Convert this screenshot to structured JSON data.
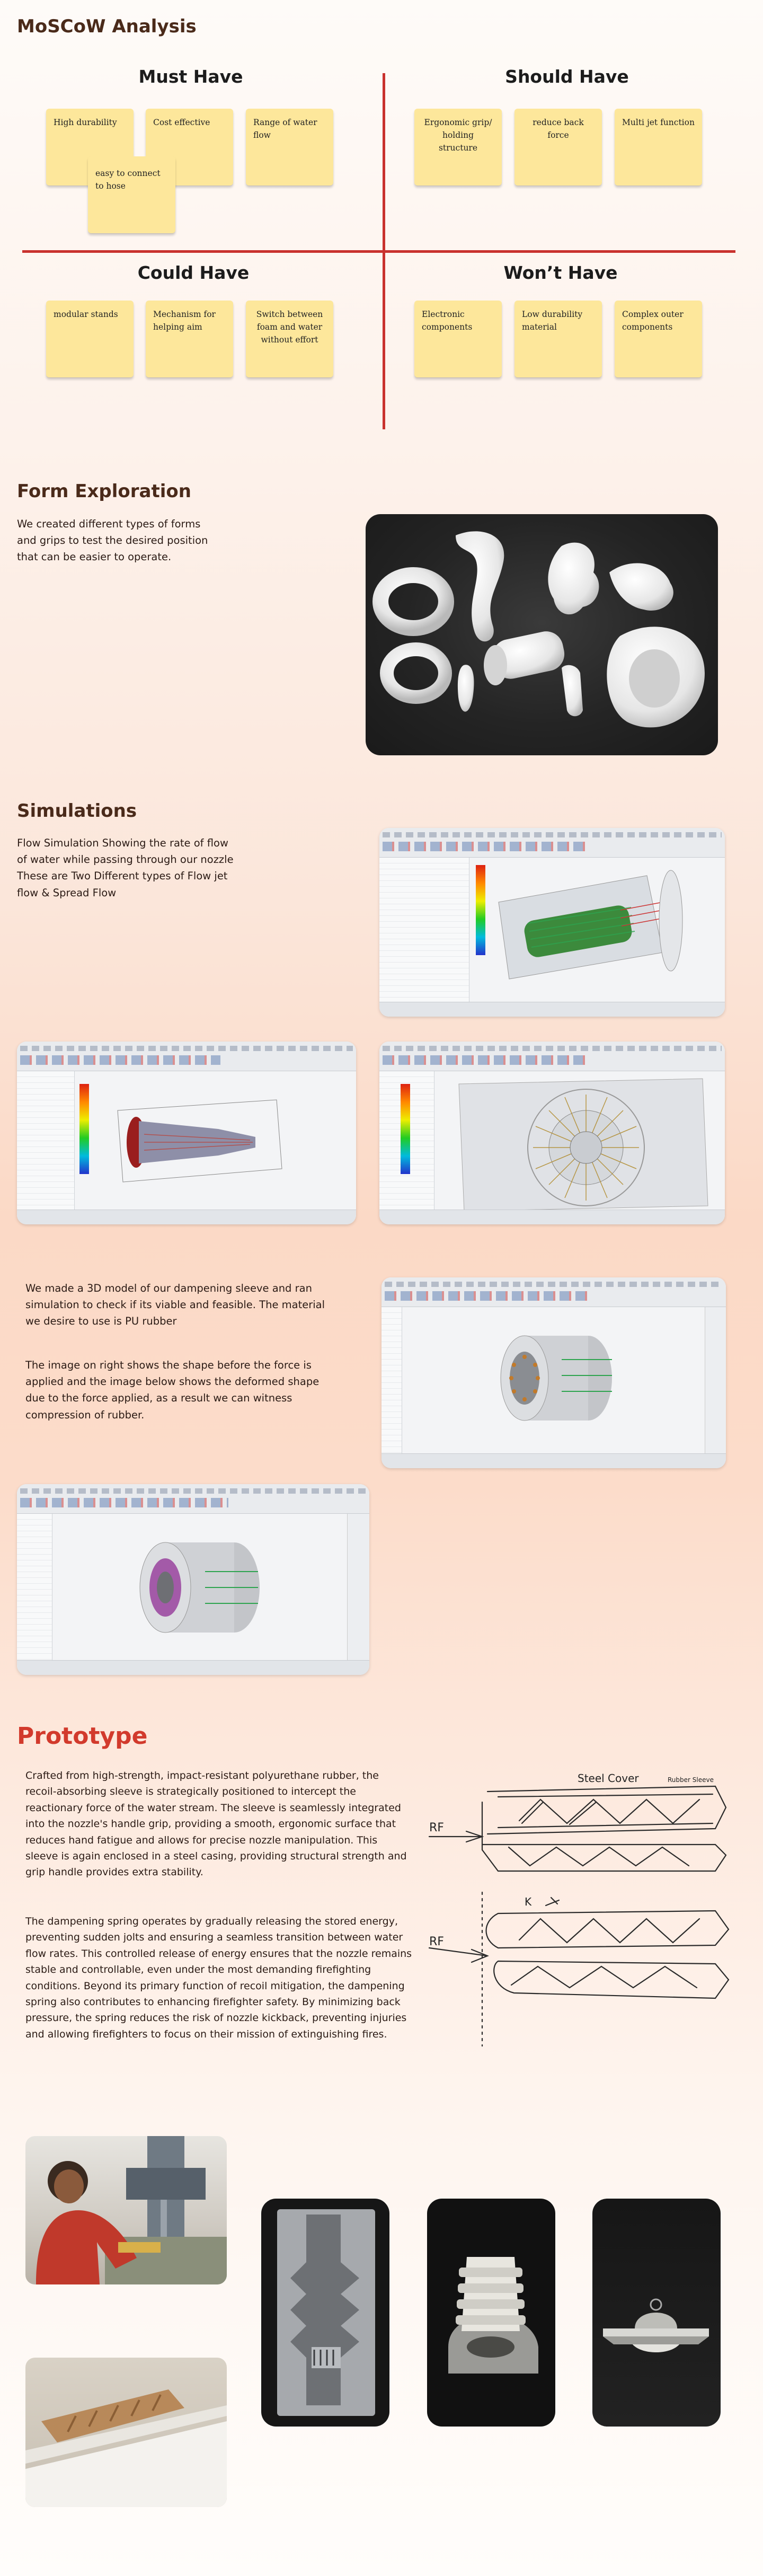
{
  "moscow": {
    "title": "MoSCoW Analysis",
    "quadrants": {
      "must": {
        "title": "Must Have",
        "notes": [
          "High durability",
          "Cost effective",
          "Range of water flow",
          "easy to connect to hose"
        ]
      },
      "should": {
        "title": "Should Have",
        "notes": [
          "Ergonomic grip/ holding structure",
          "reduce back force",
          "Multi jet function"
        ]
      },
      "could": {
        "title": "Could Have",
        "notes": [
          "modular stands",
          "Mechanism for helping aim",
          "Switch between foam and water without effort"
        ]
      },
      "wont": {
        "title": "Won’t Have",
        "notes": [
          "Electronic components",
          "Low durability material",
          "Complex outer components"
        ]
      }
    },
    "colors": {
      "axis": "#c9322e",
      "sticky": "#fde79b"
    }
  },
  "form": {
    "title": "Form Exploration",
    "text": "We created different types of forms and grips to test the desired position that can be easier to operate."
  },
  "simulations": {
    "title": "Simulations",
    "text": "Flow Simulation Showing the rate of flow of water while passing through our nozzle These are Two Different types of Flow jet flow & Spread  Flow",
    "sleeve_text_1": "We made a 3D model of our dampening sleeve and ran simulation to check if its viable and feasible. The material we desire to use is PU rubber",
    "sleeve_text_2": "The image on right shows the shape before the force is applied and the image below shows the deformed shape due to the force applied, as a result we can witness compression of rubber."
  },
  "prototype": {
    "title": "Prototype",
    "title_color": "#d23a2c",
    "para_1": "Crafted from high-strength, impact-resistant polyurethane rubber, the recoil-absorbing sleeve is strategically positioned to intercept the reactionary force of the water stream. The sleeve is seamlessly integrated into the nozzle's handle grip, providing a smooth, ergonomic surface that reduces hand fatigue and allows for precise nozzle manipulation. This sleeve is again enclosed in a steel casing, providing structural strength and grip handle provides extra stability.",
    "para_2": "The dampening spring operates by gradually releasing the stored energy, preventing sudden jolts and ensuring a seamless transition between water flow rates. This controlled release of energy ensures that the nozzle remains stable and controllable, even under the most demanding firefighting conditions. Beyond its primary function of recoil mitigation, the dampening spring also contributes to enhancing firefighter safety. By minimizing back pressure, the spring reduces the risk of nozzle kickback, preventing injuries and allowing firefighters to focus on their mission of extinguishing fires.",
    "sketch_labels": {
      "steel_cover": "Steel Cover",
      "rubber_sleeve": "Rubber Sleeve",
      "rf_1": "RF",
      "rf_2": "RF",
      "k": "K"
    }
  }
}
